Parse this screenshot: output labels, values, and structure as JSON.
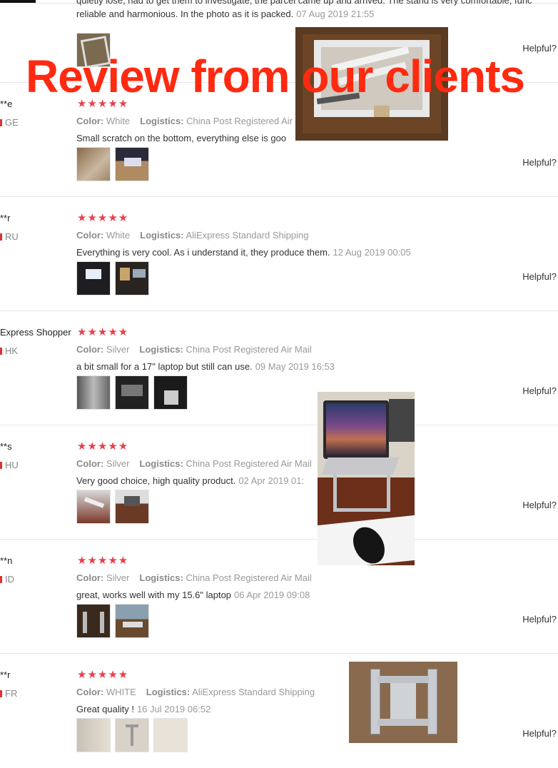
{
  "banner": {
    "title": "Review from our clients"
  },
  "helpful_label": "Helpful?",
  "first_review": {
    "line1": "quietly lose, had to get them to investigate, the parcel came up and arrived. The stand is very comfortable, func",
    "line2": "reliable and harmonious. In the photo as it is packed.",
    "date": "07 Aug 2019 21:55"
  },
  "reviews": [
    {
      "user": "**e",
      "country": "GE",
      "stars": "★★★★★",
      "color_label": "Color:",
      "color": "White",
      "logistics_label": "Logistics:",
      "logistics": "China Post Registered Air M",
      "text": "Small scratch on the bottom, everything else is goo",
      "date": ""
    },
    {
      "user": "**r",
      "country": "RU",
      "stars": "★★★★★",
      "color_label": "Color:",
      "color": "White",
      "logistics_label": "Logistics:",
      "logistics": "AliExpress Standard Shipping",
      "text": "Everything is very cool. As i understand it, they produce them.",
      "date": "12 Aug 2019 00:05"
    },
    {
      "user": "Express Shopper",
      "country": "HK",
      "stars": "★★★★★",
      "color_label": "Color:",
      "color": "Silver",
      "logistics_label": "Logistics:",
      "logistics": "China Post Registered Air Mail",
      "text": "a bit small for a 17\" laptop but still can use.",
      "date": "09 May 2019 16:53"
    },
    {
      "user": "**s",
      "country": "HU",
      "stars": "★★★★★",
      "color_label": "Color:",
      "color": "Silver",
      "logistics_label": "Logistics:",
      "logistics": "China Post Registered Air Mail",
      "text": "Very good choice, high quality product.",
      "date": "02 Apr 2019 01:"
    },
    {
      "user": "**n",
      "country": "ID",
      "stars": "★★★★★",
      "color_label": "Color:",
      "color": "Silver",
      "logistics_label": "Logistics:",
      "logistics": "China Post Registered Air Mail",
      "text": "great, works well with my 15.6\" laptop",
      "date": "06 Apr 2019 09:08"
    },
    {
      "user": "**r",
      "country": "FR",
      "stars": "★★★★★",
      "color_label": "Color:",
      "color": "WHITE",
      "logistics_label": "Logistics:",
      "logistics": "AliExpress Standard Shipping",
      "text": "Great quality !",
      "date": "16 Jul 2019 06:52"
    }
  ]
}
